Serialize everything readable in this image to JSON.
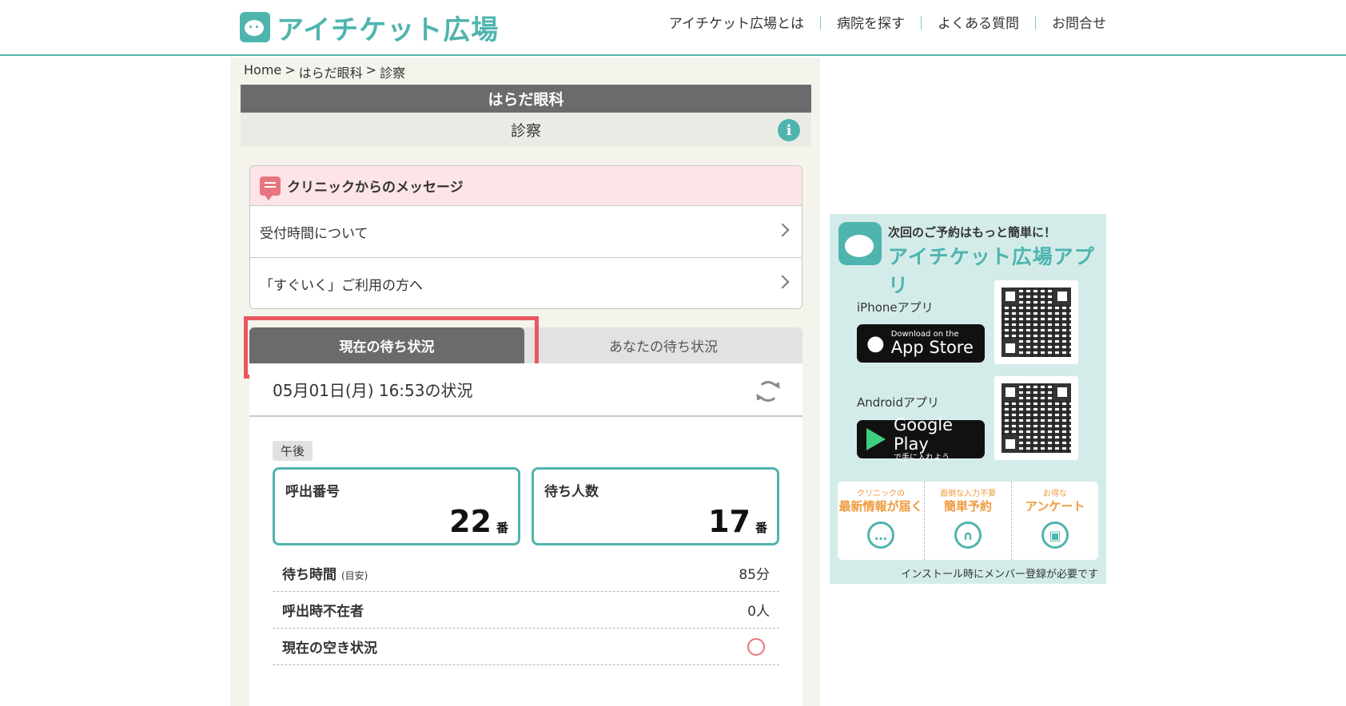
{
  "header": {
    "logo_text": "アイチケット広場",
    "nav": [
      "アイチケット広場とは",
      "病院を探す",
      "よくある質問",
      "お問合せ"
    ],
    "nav_separator": "｜"
  },
  "breadcrumb": {
    "home": "Home",
    "sep": ">",
    "clinic": "はらだ眼科",
    "current": "診察"
  },
  "clinic": {
    "name": "はらだ眼科",
    "page": "診察",
    "info_icon": "i"
  },
  "messages": {
    "title": "クリニックからのメッセージ",
    "items": [
      "受付時間について",
      "「すぐいく」ご利用の方へ"
    ]
  },
  "tabs": {
    "active": "現在の待ち状況",
    "inactive": "あなたの待ち状況"
  },
  "status": {
    "timestamp": "05月01日(月) 16:53の状況",
    "period_badge": "午後",
    "call_number_label": "呼出番号",
    "call_number_value": "22",
    "call_number_unit": "番",
    "waiting_count_label": "待ち人数",
    "waiting_count_value": "17",
    "waiting_count_unit": "番",
    "wait_time_label": "待ち時間",
    "wait_time_note": "(目安)",
    "wait_time_value": "85分",
    "absent_label": "呼出時不在者",
    "absent_value": "0人",
    "vacancy_label": "現在の空き状況",
    "vacancy_symbol": "○"
  },
  "app_banner": {
    "tagline": "次回のご予約はもっと簡単に！",
    "title": "アイチケット広場アプリ",
    "iphone_label": "iPhoneアプリ",
    "appstore_small": "Download on the",
    "appstore_big": "App Store",
    "android_label": "Androidアプリ",
    "googleplay_big": "Google Play",
    "googleplay_small": "で手に入れよう",
    "features": [
      {
        "small": "クリニックの",
        "big": "最新情報が届く",
        "icon": "chat-icon"
      },
      {
        "small": "面倒な入力不要",
        "big": "簡単予約",
        "icon": "stethoscope-icon"
      },
      {
        "small": "お得な",
        "big": "アンケート",
        "icon": "gift-icon"
      }
    ],
    "note": "インストール時にメンバー登録が必要です"
  },
  "colors": {
    "accent": "#4fb4ae",
    "highlight": "#e9565e",
    "message_bg": "#fde4e6",
    "feature_text": "#f09a3e"
  }
}
